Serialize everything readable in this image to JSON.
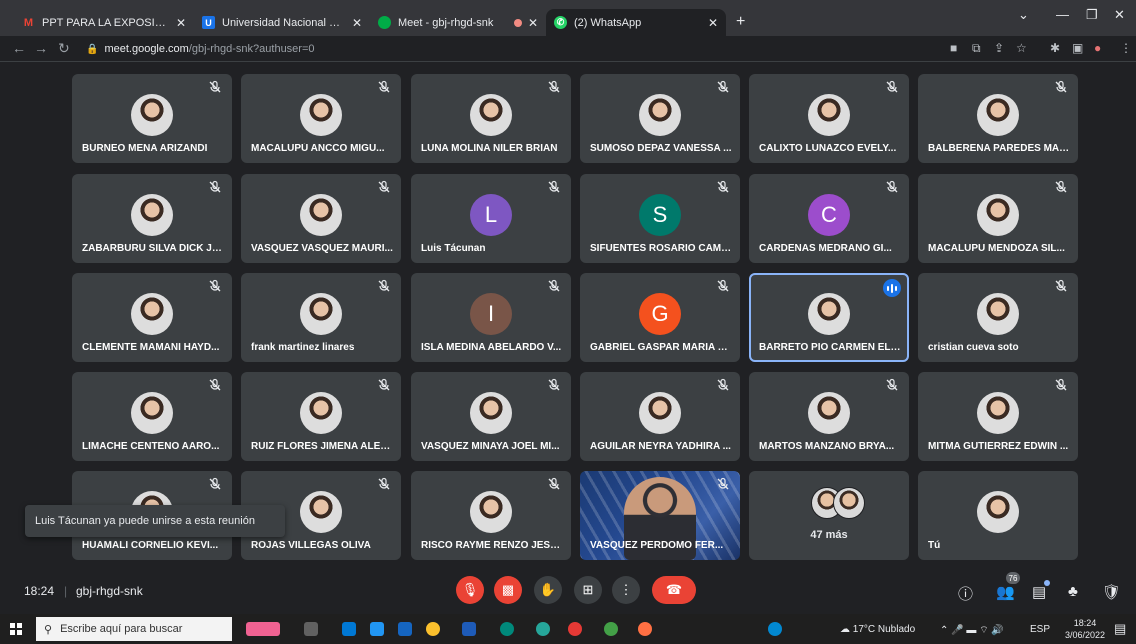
{
  "browser": {
    "tabs": [
      {
        "label": "PPT PARA LA EXPOSICIÓN DEL II",
        "icon": "gmail-icon",
        "color": "#ea4335"
      },
      {
        "label": "Universidad Nacional del Callao",
        "icon": "university-icon",
        "color": "#1a73e8"
      },
      {
        "label": "Meet - gbj-rhgd-snk",
        "icon": "meet-icon",
        "color": "#00ac47"
      },
      {
        "label": "(2) WhatsApp",
        "icon": "whatsapp-icon",
        "color": "#25d366"
      }
    ],
    "url_host": "meet.google.com",
    "url_path": "/gbj-rhgd-snk?authuser=0"
  },
  "participants": [
    {
      "name": "BURNEO MENA ARIZANDI",
      "kind": "photo"
    },
    {
      "name": "MACALUPÚ ANCCO MIGU...",
      "kind": "photo"
    },
    {
      "name": "LUNA MOLINA NILER BRIAN",
      "kind": "photo"
    },
    {
      "name": "SUMOSO DEPAZ VANESSA ...",
      "kind": "photo"
    },
    {
      "name": "CALIXTO LUNAZCO EVELY...",
      "kind": "photo"
    },
    {
      "name": "BALBERENA PAREDES MAR...",
      "kind": "photo"
    },
    {
      "name": "ZABARBURU SILVA DICK JH...",
      "kind": "photo"
    },
    {
      "name": "VASQUEZ VASQUEZ MAURI...",
      "kind": "photo"
    },
    {
      "name": "Luis Tácunan",
      "kind": "letter",
      "letter": "L",
      "color": "#7e57c2"
    },
    {
      "name": "SIFUENTES ROSARIO CAMI...",
      "kind": "letter",
      "letter": "S",
      "color": "#00796b"
    },
    {
      "name": "CARDENAS MEDRANO GI...",
      "kind": "letter",
      "letter": "C",
      "color": "#9c4dcc"
    },
    {
      "name": "MACALUPU MENDOZA SIL...",
      "kind": "photo"
    },
    {
      "name": "CLEMENTE MAMANI HAYD...",
      "kind": "photo"
    },
    {
      "name": "frank martinez linares",
      "kind": "photo"
    },
    {
      "name": "ISLA MEDINA ABELARDO V...",
      "kind": "letter",
      "letter": "I",
      "color": "#795548"
    },
    {
      "name": "GABRIEL GASPAR MARIA L...",
      "kind": "letter",
      "letter": "G",
      "color": "#f4511e"
    },
    {
      "name": "BARRETO PIO CARMEN ELI...",
      "kind": "photo",
      "speaking": true
    },
    {
      "name": "cristian cueva soto",
      "kind": "photo"
    },
    {
      "name": "LIMACHE CENTENO AARO...",
      "kind": "photo"
    },
    {
      "name": "RUIZ FLORES JIMENA ALEX...",
      "kind": "photo"
    },
    {
      "name": "VASQUEZ MINAYA JOEL MI...",
      "kind": "photo"
    },
    {
      "name": "AGUILAR NEYRA YADHIRA ...",
      "kind": "photo"
    },
    {
      "name": "MARTOS MANZANO BRYA...",
      "kind": "photo"
    },
    {
      "name": "MITMA GUTIERREZ EDWIN ...",
      "kind": "photo"
    },
    {
      "name": "HUAMALI CORNELIO KEVI...",
      "kind": "photo"
    },
    {
      "name": "ROJAS VILLEGAS OLIVA",
      "kind": "photo"
    },
    {
      "name": "RISCO RAYME RENZO JESUS",
      "kind": "photo"
    },
    {
      "name": "VASQUEZ PERDOMO FER...",
      "kind": "video"
    },
    {
      "name": "47 más",
      "kind": "more"
    },
    {
      "name": "Tú",
      "kind": "photo"
    }
  ],
  "toast": "Luis Tácunan ya puede unirse a esta reunión",
  "meeting": {
    "time": "18:24",
    "separator": "|",
    "code": "gbj-rhgd-snk",
    "participant_count": "76"
  },
  "taskbar": {
    "search_placeholder": "Escribe aquí para buscar",
    "weather": "17°C Nublado",
    "lang": "ESP",
    "time": "18:24",
    "date": "3/06/2022"
  }
}
